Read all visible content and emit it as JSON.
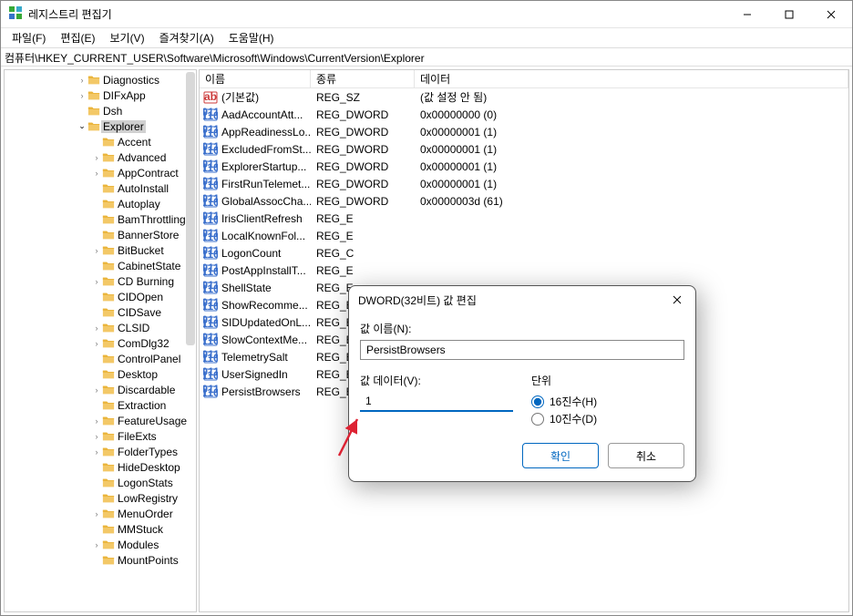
{
  "window": {
    "title": "레지스트리 편집기"
  },
  "menu": {
    "file": "파일(F)",
    "edit": "편집(E)",
    "view": "보기(V)",
    "fav": "즐겨찾기(A)",
    "help": "도움말(H)"
  },
  "address": "컴퓨터\\HKEY_CURRENT_USER\\Software\\Microsoft\\Windows\\CurrentVersion\\Explorer",
  "tree": [
    {
      "indent": 5,
      "chev": "closed",
      "label": "Diagnostics"
    },
    {
      "indent": 5,
      "chev": "closed",
      "label": "DIFxApp"
    },
    {
      "indent": 5,
      "chev": "none",
      "label": "Dsh"
    },
    {
      "indent": 5,
      "chev": "open",
      "label": "Explorer",
      "selected": true
    },
    {
      "indent": 6,
      "chev": "none",
      "label": "Accent"
    },
    {
      "indent": 6,
      "chev": "closed",
      "label": "Advanced"
    },
    {
      "indent": 6,
      "chev": "closed",
      "label": "AppContract"
    },
    {
      "indent": 6,
      "chev": "none",
      "label": "AutoInstall"
    },
    {
      "indent": 6,
      "chev": "none",
      "label": "Autoplay"
    },
    {
      "indent": 6,
      "chev": "none",
      "label": "BamThrottling"
    },
    {
      "indent": 6,
      "chev": "none",
      "label": "BannerStore"
    },
    {
      "indent": 6,
      "chev": "closed",
      "label": "BitBucket"
    },
    {
      "indent": 6,
      "chev": "none",
      "label": "CabinetState"
    },
    {
      "indent": 6,
      "chev": "closed",
      "label": "CD Burning"
    },
    {
      "indent": 6,
      "chev": "none",
      "label": "CIDOpen"
    },
    {
      "indent": 6,
      "chev": "none",
      "label": "CIDSave"
    },
    {
      "indent": 6,
      "chev": "closed",
      "label": "CLSID"
    },
    {
      "indent": 6,
      "chev": "closed",
      "label": "ComDlg32"
    },
    {
      "indent": 6,
      "chev": "none",
      "label": "ControlPanel"
    },
    {
      "indent": 6,
      "chev": "none",
      "label": "Desktop"
    },
    {
      "indent": 6,
      "chev": "closed",
      "label": "Discardable"
    },
    {
      "indent": 6,
      "chev": "none",
      "label": "Extraction"
    },
    {
      "indent": 6,
      "chev": "closed",
      "label": "FeatureUsage"
    },
    {
      "indent": 6,
      "chev": "closed",
      "label": "FileExts"
    },
    {
      "indent": 6,
      "chev": "closed",
      "label": "FolderTypes"
    },
    {
      "indent": 6,
      "chev": "none",
      "label": "HideDesktop"
    },
    {
      "indent": 6,
      "chev": "none",
      "label": "LogonStats"
    },
    {
      "indent": 6,
      "chev": "none",
      "label": "LowRegistry"
    },
    {
      "indent": 6,
      "chev": "closed",
      "label": "MenuOrder"
    },
    {
      "indent": 6,
      "chev": "none",
      "label": "MMStuck"
    },
    {
      "indent": 6,
      "chev": "closed",
      "label": "Modules"
    },
    {
      "indent": 6,
      "chev": "none",
      "label": "MountPoints"
    }
  ],
  "columns": {
    "name": "이름",
    "type": "종류",
    "data": "데이터"
  },
  "values": [
    {
      "icon": "ab",
      "name": "(기본값)",
      "type": "REG_SZ",
      "data": "(값 설정 안 됨)"
    },
    {
      "icon": "bin",
      "name": "AadAccountAtt...",
      "type": "REG_DWORD",
      "data": "0x00000000 (0)"
    },
    {
      "icon": "bin",
      "name": "AppReadinessLo...",
      "type": "REG_DWORD",
      "data": "0x00000001 (1)"
    },
    {
      "icon": "bin",
      "name": "ExcludedFromSt...",
      "type": "REG_DWORD",
      "data": "0x00000001 (1)"
    },
    {
      "icon": "bin",
      "name": "ExplorerStartup...",
      "type": "REG_DWORD",
      "data": "0x00000001 (1)"
    },
    {
      "icon": "bin",
      "name": "FirstRunTelemet...",
      "type": "REG_DWORD",
      "data": "0x00000001 (1)"
    },
    {
      "icon": "bin",
      "name": "GlobalAssocCha...",
      "type": "REG_DWORD",
      "data": "0x0000003d (61)"
    },
    {
      "icon": "bin",
      "name": "IrisClientRefresh",
      "type": "REG_E",
      "data": ""
    },
    {
      "icon": "bin",
      "name": "LocalKnownFol...",
      "type": "REG_E",
      "data": ""
    },
    {
      "icon": "bin",
      "name": "LogonCount",
      "type": "REG_C",
      "data": ""
    },
    {
      "icon": "bin",
      "name": "PostAppInstallT...",
      "type": "REG_E",
      "data": ""
    },
    {
      "icon": "bin",
      "name": "ShellState",
      "type": "REG_E",
      "data": ""
    },
    {
      "icon": "bin",
      "name": "ShowRecomme...",
      "type": "REG_E",
      "data": ""
    },
    {
      "icon": "bin",
      "name": "SIDUpdatedOnL...",
      "type": "REG_E",
      "data": ""
    },
    {
      "icon": "bin",
      "name": "SlowContextMe...",
      "type": "REG_E",
      "data": ""
    },
    {
      "icon": "bin",
      "name": "TelemetrySalt",
      "type": "REG_E",
      "data": ""
    },
    {
      "icon": "bin",
      "name": "UserSignedIn",
      "type": "REG_E",
      "data": ""
    },
    {
      "icon": "bin",
      "name": "PersistBrowsers",
      "type": "REG_E",
      "data": ""
    }
  ],
  "dialog": {
    "title": "DWORD(32비트) 값 편집",
    "name_label": "값 이름(N):",
    "name_value": "PersistBrowsers",
    "data_label": "값 데이터(V):",
    "data_value": "1",
    "base_label": "단위",
    "hex": "16진수(H)",
    "dec": "10진수(D)",
    "ok": "확인",
    "cancel": "취소"
  }
}
